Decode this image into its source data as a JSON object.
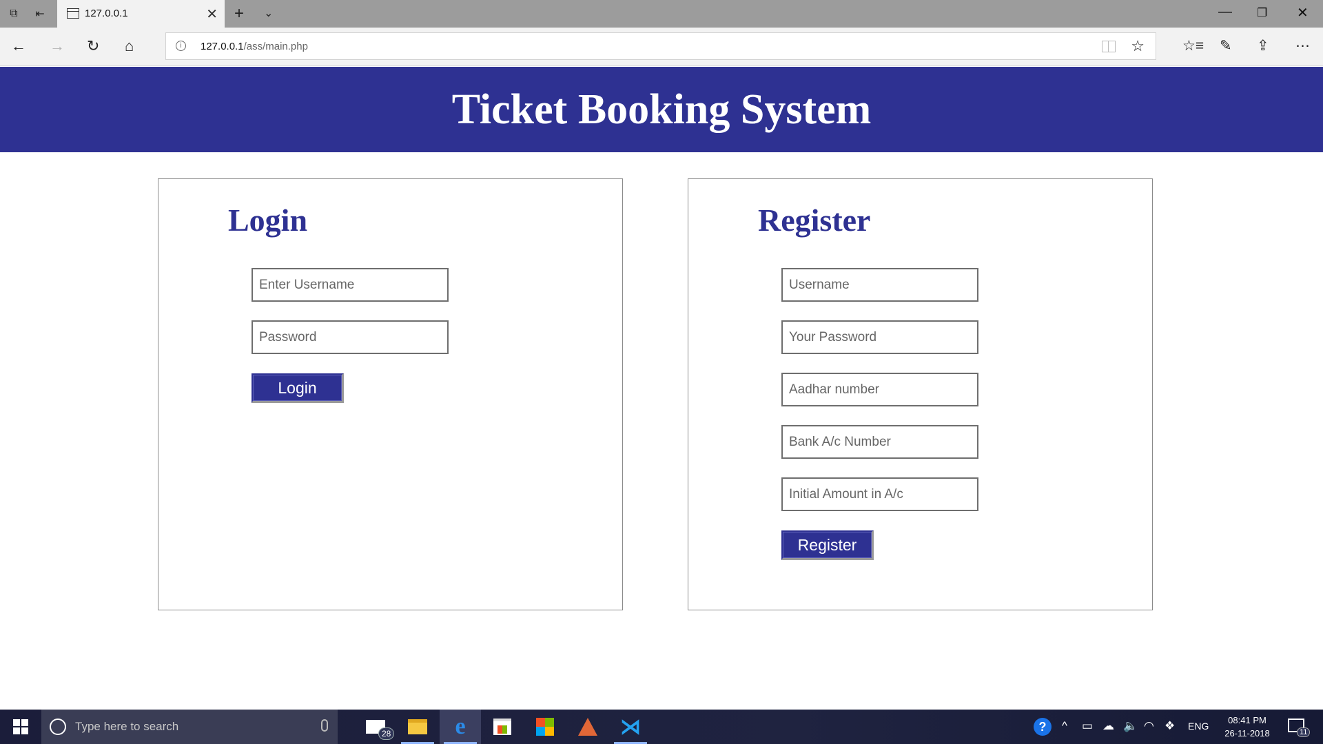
{
  "browser": {
    "tab_title": "127.0.0.1",
    "url_host": "127.0.0.1",
    "url_path": "/ass/main.php"
  },
  "header": {
    "title": "Ticket Booking System",
    "background_color": "#2e3192"
  },
  "login": {
    "heading": "Login",
    "username_placeholder": "Enter Username",
    "password_placeholder": "Password",
    "submit_label": "Login"
  },
  "register": {
    "heading": "Register",
    "username_placeholder": "Username",
    "password_placeholder": "Your Password",
    "aadhar_placeholder": "Aadhar number",
    "bank_placeholder": "Bank A/c Number",
    "amount_placeholder": "Initial Amount in A/c",
    "submit_label": "Register"
  },
  "taskbar": {
    "search_placeholder": "Type here to search",
    "mail_badge": "28",
    "language": "ENG",
    "time": "08:41 PM",
    "date": "26-11-2018",
    "notification_count": "11",
    "apps": [
      "mail-icon",
      "file-explorer-icon",
      "edge-icon",
      "store-icon",
      "office-icon",
      "matlab-icon",
      "vscode-icon"
    ]
  }
}
